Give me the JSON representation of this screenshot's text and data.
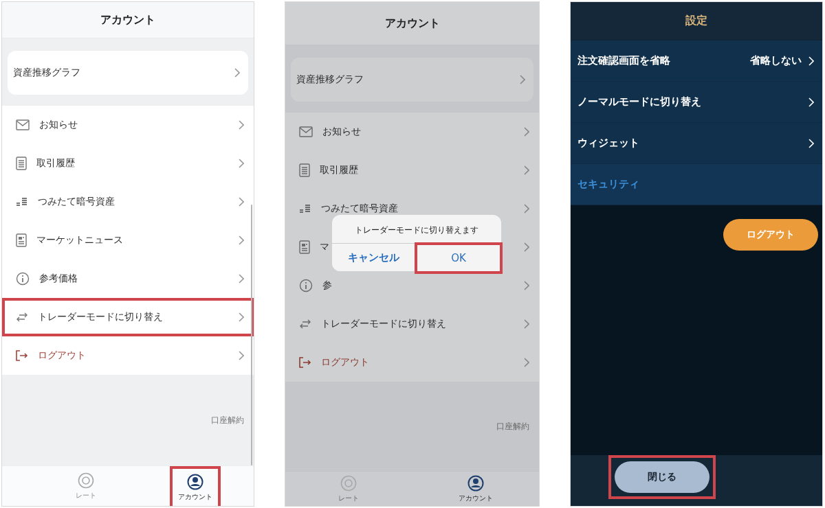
{
  "screens": [
    {
      "kind": "account",
      "dimmed": false,
      "title": "アカウント",
      "graph_item": "資産推移グラフ",
      "menu": [
        {
          "kind": "mail",
          "label": "お知らせ",
          "highlighted": false
        },
        {
          "kind": "list",
          "label": "取引履歴",
          "highlighted": false
        },
        {
          "kind": "savings",
          "label": "つみたて暗号資産",
          "highlighted": false
        },
        {
          "kind": "news",
          "label": "マーケットニュース",
          "highlighted": false
        },
        {
          "kind": "info",
          "label": "参考価格",
          "highlighted": false
        },
        {
          "kind": "switch",
          "label": "トレーダーモードに切り替え",
          "highlighted": true
        },
        {
          "kind": "logout",
          "label": "ログアウト",
          "highlighted": false
        }
      ],
      "footer_link": "口座解約",
      "tabs": [
        {
          "kind": "coin",
          "label": "レート",
          "selected": false,
          "highlighted": false
        },
        {
          "kind": "person",
          "label": "アカウント",
          "selected": true,
          "highlighted": true
        }
      ]
    },
    {
      "kind": "account",
      "dimmed": true,
      "title": "アカウント",
      "graph_item": "資産推移グラフ",
      "menu": [
        {
          "kind": "mail",
          "label": "お知らせ",
          "highlighted": false
        },
        {
          "kind": "list",
          "label": "取引履歴",
          "highlighted": false
        },
        {
          "kind": "savings",
          "label": "つみたて暗号資産",
          "highlighted": false
        },
        {
          "kind": "news",
          "label": "マ",
          "highlighted": false
        },
        {
          "kind": "info",
          "label": "参",
          "highlighted": false
        },
        {
          "kind": "switch",
          "label": "トレーダーモードに切り替え",
          "highlighted": false
        },
        {
          "kind": "logout",
          "label": "ログアウト",
          "highlighted": false
        }
      ],
      "footer_link": "口座解約",
      "tabs": [
        {
          "kind": "coin",
          "label": "レート",
          "selected": false,
          "highlighted": false
        },
        {
          "kind": "person",
          "label": "アカウント",
          "selected": true,
          "highlighted": false
        }
      ],
      "dialog": {
        "message": "トレーダーモードに切り替えます",
        "buttons": [
          {
            "label": "キャンセル",
            "highlighted": false
          },
          {
            "label": "OK",
            "highlighted": true
          }
        ]
      }
    },
    {
      "kind": "settings",
      "title": "設定",
      "items": [
        {
          "kind": "link",
          "label": "注文確認画面を省略",
          "value": "省略しない"
        },
        {
          "kind": "link",
          "label": "ノーマルモードに切り替え"
        },
        {
          "kind": "link",
          "label": "ウィジェット"
        },
        {
          "kind": "section",
          "label": "セキュリティ"
        }
      ],
      "logout": "ログアウト",
      "close": {
        "label": "閉じる",
        "highlighted": true
      }
    }
  ]
}
